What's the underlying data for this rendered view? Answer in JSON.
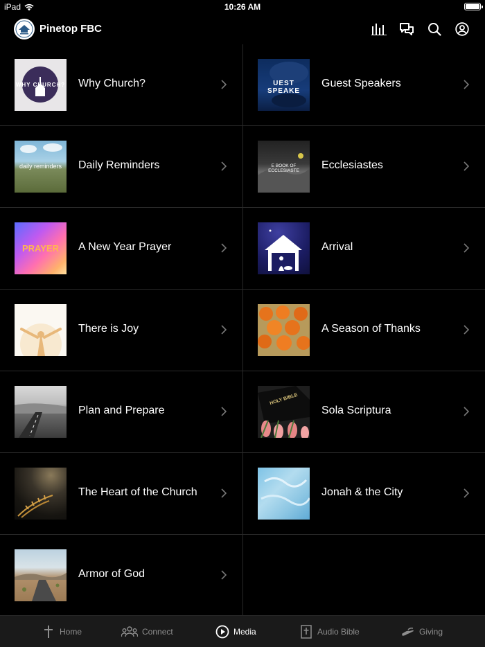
{
  "status": {
    "carrier": "iPad",
    "time": "10:26 AM",
    "battery_level": 1.0
  },
  "header": {
    "title": "Pinetop FBC",
    "icons": [
      "equalizer-icon",
      "chat-icon",
      "search-icon",
      "profile-icon"
    ]
  },
  "items": [
    {
      "title": "Why Church?",
      "thumb_text": "WHY CHURCH?"
    },
    {
      "title": "Guest Speakers",
      "thumb_text": "UEST SPEAKE"
    },
    {
      "title": "Daily Reminders",
      "thumb_text": "daily reminders"
    },
    {
      "title": "Ecclesiastes",
      "thumb_text": "E BOOK OF ECCLESIASTE"
    },
    {
      "title": "A New Year Prayer",
      "thumb_text": "PRAYER"
    },
    {
      "title": "Arrival"
    },
    {
      "title": "There is Joy"
    },
    {
      "title": "A Season of Thanks"
    },
    {
      "title": "Plan and Prepare"
    },
    {
      "title": "Sola Scriptura",
      "thumb_text": "HOLY BIBLE"
    },
    {
      "title": "The Heart of the Church"
    },
    {
      "title": "Jonah & the City"
    },
    {
      "title": "Armor of God"
    }
  ],
  "tabs": [
    {
      "label": "Home",
      "icon": "cross-icon"
    },
    {
      "label": "Connect",
      "icon": "people-icon"
    },
    {
      "label": "Media",
      "icon": "play-circle-icon"
    },
    {
      "label": "Audio Bible",
      "icon": "bible-icon"
    },
    {
      "label": "Giving",
      "icon": "hand-icon"
    }
  ],
  "active_tab": "Media",
  "colors": {
    "background": "#000000",
    "tabbar": "#1a1a1a",
    "divider": "#2a2a2a",
    "inactive": "#8e8e8e"
  }
}
